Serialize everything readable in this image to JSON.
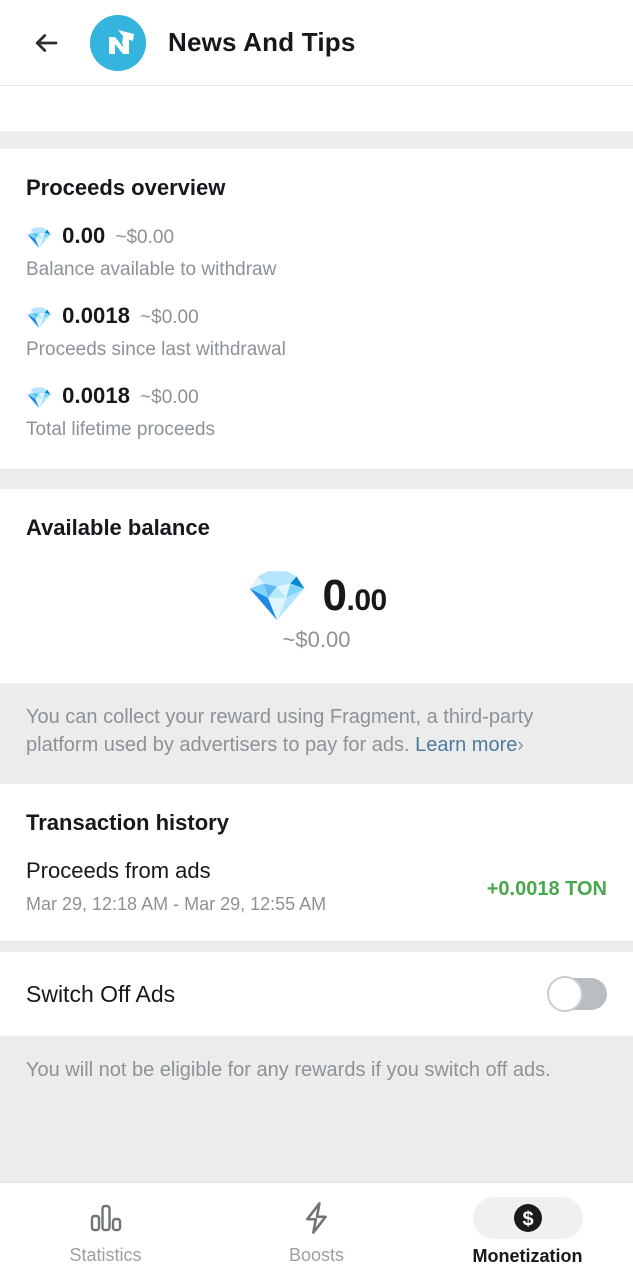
{
  "header": {
    "back_icon": "arrow-left-icon",
    "logo_icon": "nt-channel-logo",
    "title": "News And Tips"
  },
  "proceeds": {
    "title": "Proceeds overview",
    "rows": [
      {
        "gem": "💎",
        "value": "0.00",
        "usd": "~$0.00",
        "label": "Balance available to withdraw"
      },
      {
        "gem": "💎",
        "value": "0.0018",
        "usd": "~$0.00",
        "label": "Proceeds since last withdrawal"
      },
      {
        "gem": "💎",
        "value": "0.0018",
        "usd": "~$0.00",
        "label": "Total lifetime proceeds"
      }
    ]
  },
  "balance": {
    "title": "Available balance",
    "gem": "💎",
    "whole": "0",
    "decimal": ".00",
    "usd": "~$0.00",
    "note_text": "You can collect your reward using Fragment, a third-party platform used by advertisers to pay for ads. ",
    "note_link": "Learn more",
    "note_chevron": "›"
  },
  "transactions": {
    "title": "Transaction history",
    "items": [
      {
        "name": "Proceeds from ads",
        "date": "Mar 29, 12:18 AM - Mar 29, 12:55 AM",
        "amount": "+0.0018 TON"
      }
    ]
  },
  "switch_ads": {
    "label": "Switch Off Ads",
    "state": "off",
    "note": "You will not be eligible for any rewards if you switch off ads."
  },
  "bottom_nav": {
    "items": [
      {
        "icon": "bar-chart-icon",
        "label": "Statistics",
        "active": false
      },
      {
        "icon": "lightning-bolt-icon",
        "label": "Boosts",
        "active": false
      },
      {
        "icon": "dollar-circle-icon",
        "label": "Monetization",
        "active": true
      }
    ]
  },
  "colors": {
    "brand_cyan": "#35b5dd",
    "accent_green": "#4aa84c",
    "link_blue": "#4a7d9c",
    "muted_text": "#8b9298",
    "page_bg": "#ececec"
  }
}
